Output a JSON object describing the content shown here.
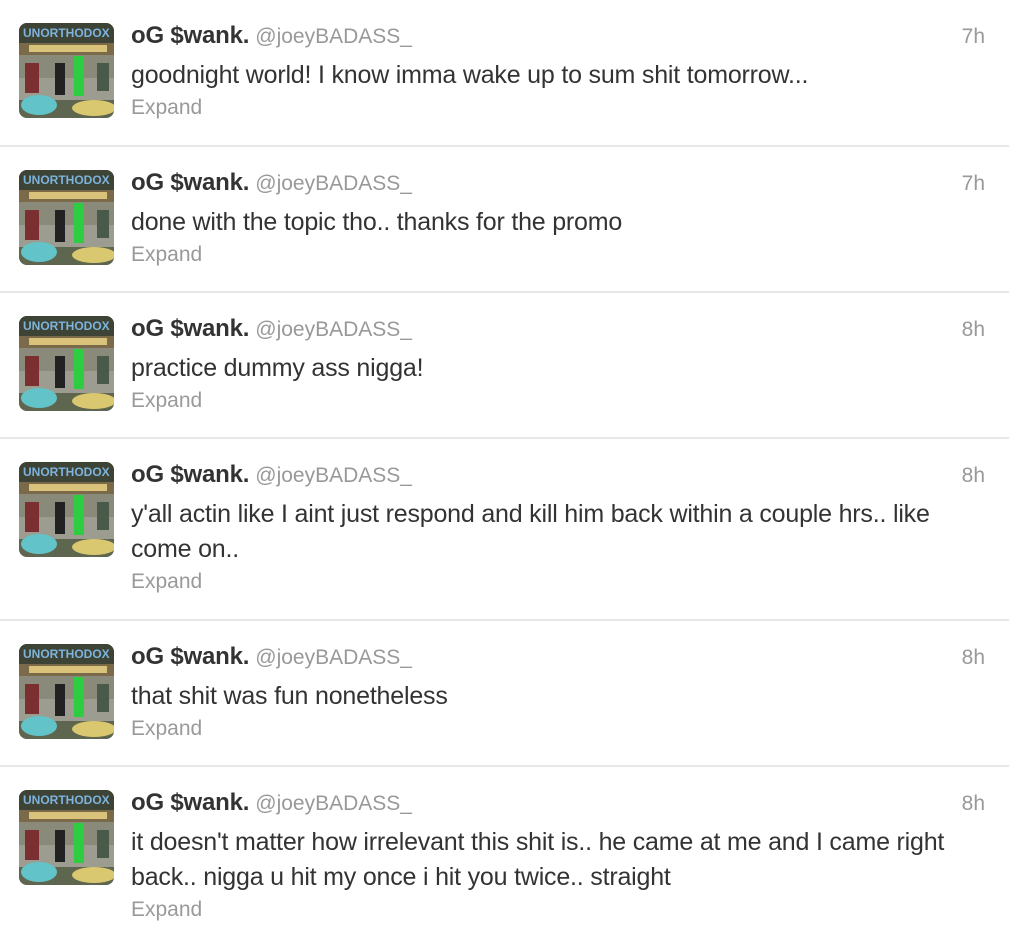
{
  "tweets": [
    {
      "fullname": "oG $wank.",
      "username": "@joeyBADASS_",
      "time": "7h",
      "text": "goodnight world! I know imma wake up to sum shit tomorrow...",
      "expand": "Expand",
      "avatar_text": "UNORTHODOX"
    },
    {
      "fullname": "oG $wank.",
      "username": "@joeyBADASS_",
      "time": "7h",
      "text": "done with the topic tho.. thanks for the promo",
      "expand": "Expand",
      "avatar_text": "UNORTHODOX"
    },
    {
      "fullname": "oG $wank.",
      "username": "@joeyBADASS_",
      "time": "8h",
      "text": "practice dummy ass nigga!",
      "expand": "Expand",
      "avatar_text": "UNORTHODOX"
    },
    {
      "fullname": "oG $wank.",
      "username": "@joeyBADASS_",
      "time": "8h",
      "text": "y'all actin like I aint just respond and kill him back within a couple hrs.. like come on..",
      "expand": "Expand",
      "avatar_text": "UNORTHODOX"
    },
    {
      "fullname": "oG $wank.",
      "username": "@joeyBADASS_",
      "time": "8h",
      "text": "that shit was fun nonetheless",
      "expand": "Expand",
      "avatar_text": "UNORTHODOX"
    },
    {
      "fullname": "oG $wank.",
      "username": "@joeyBADASS_",
      "time": "8h",
      "text": "it doesn't matter how irrelevant this shit is.. he came at me and I came right back.. nigga u hit my once i hit you twice.. straight",
      "expand": "Expand",
      "avatar_text": "UNORTHODOX"
    }
  ],
  "colors": {
    "name": "#333333",
    "muted": "#999999",
    "divider": "#e8e8e8",
    "avatar_title": "#6fa0c8",
    "avatar_accent": "#2ecc40"
  }
}
